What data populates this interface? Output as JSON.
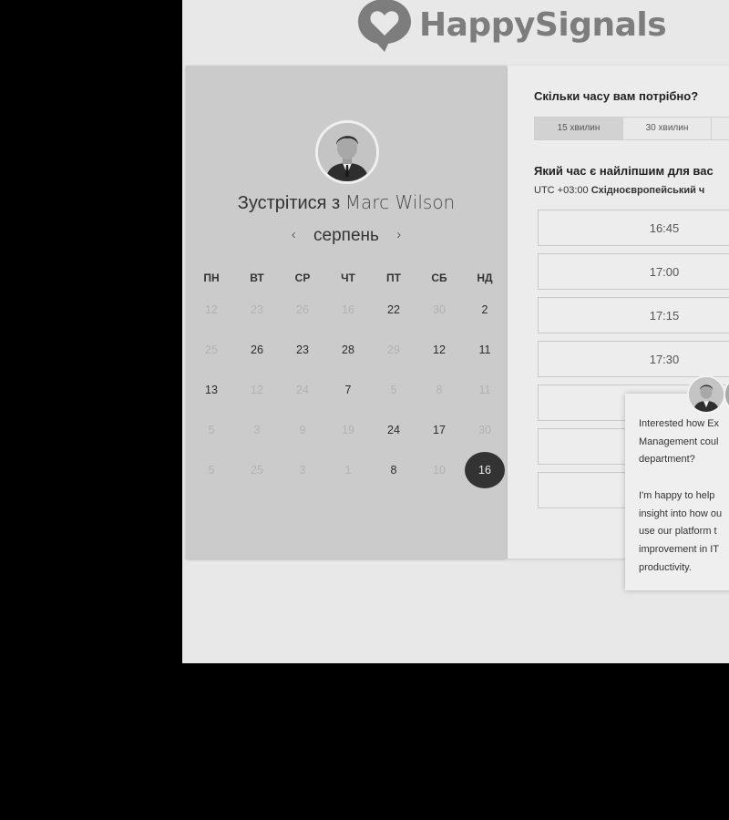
{
  "brand": {
    "name": "HappySignals",
    "logo_icon": "heart-speech-bubble-icon",
    "color": "#7d7d7d"
  },
  "scheduler": {
    "meet_prefix": "Зустрітися з",
    "host_name": "Marc Wilson",
    "month": "серпень",
    "prev_icon": "‹",
    "next_icon": "›",
    "weekdays": [
      "ПН",
      "ВТ",
      "СР",
      "ЧТ",
      "ПТ",
      "СБ",
      "НД"
    ],
    "weeks": [
      [
        {
          "d": "12",
          "on": false
        },
        {
          "d": "23",
          "on": false
        },
        {
          "d": "26",
          "on": false
        },
        {
          "d": "16",
          "on": false
        },
        {
          "d": "22",
          "on": true
        },
        {
          "d": "30",
          "on": false
        },
        {
          "d": "2",
          "on": true
        }
      ],
      [
        {
          "d": "25",
          "on": false
        },
        {
          "d": "26",
          "on": true
        },
        {
          "d": "23",
          "on": true
        },
        {
          "d": "28",
          "on": true
        },
        {
          "d": "29",
          "on": false
        },
        {
          "d": "12",
          "on": true
        },
        {
          "d": "11",
          "on": true
        }
      ],
      [
        {
          "d": "13",
          "on": true
        },
        {
          "d": "12",
          "on": false
        },
        {
          "d": "24",
          "on": false
        },
        {
          "d": "7",
          "on": true
        },
        {
          "d": "5",
          "on": false
        },
        {
          "d": "8",
          "on": false
        },
        {
          "d": "11",
          "on": false
        }
      ],
      [
        {
          "d": "5",
          "on": false
        },
        {
          "d": "3",
          "on": false
        },
        {
          "d": "9",
          "on": false
        },
        {
          "d": "19",
          "on": false
        },
        {
          "d": "24",
          "on": true
        },
        {
          "d": "17",
          "on": true
        },
        {
          "d": "30",
          "on": false
        }
      ],
      [
        {
          "d": "5",
          "on": false
        },
        {
          "d": "25",
          "on": false
        },
        {
          "d": "3",
          "on": false
        },
        {
          "d": "1",
          "on": false
        },
        {
          "d": "8",
          "on": true
        },
        {
          "d": "10",
          "on": false
        },
        {
          "d": "16",
          "on": true,
          "selected": true
        }
      ]
    ]
  },
  "booking": {
    "duration_question": "Скільки часу вам потрібно?",
    "durations": [
      {
        "label": "15 хвилин",
        "active": true
      },
      {
        "label": "30 хвилин",
        "active": false
      },
      {
        "label": "",
        "active": false
      }
    ],
    "time_question": "Який час є найліпшим для вас",
    "timezone_offset": "UTC +03:00",
    "timezone_name": "Східноєвропейський ч",
    "slots": [
      "16:45",
      "17:00",
      "17:15",
      "17:30",
      "",
      "",
      ""
    ]
  },
  "chat": {
    "message": "Interested how Ex\nManagement coul\ndepartment?\n\nI'm happy to help\ninsight into how ou\nuse our platform t\nimprovement in IT\nproductivity."
  }
}
